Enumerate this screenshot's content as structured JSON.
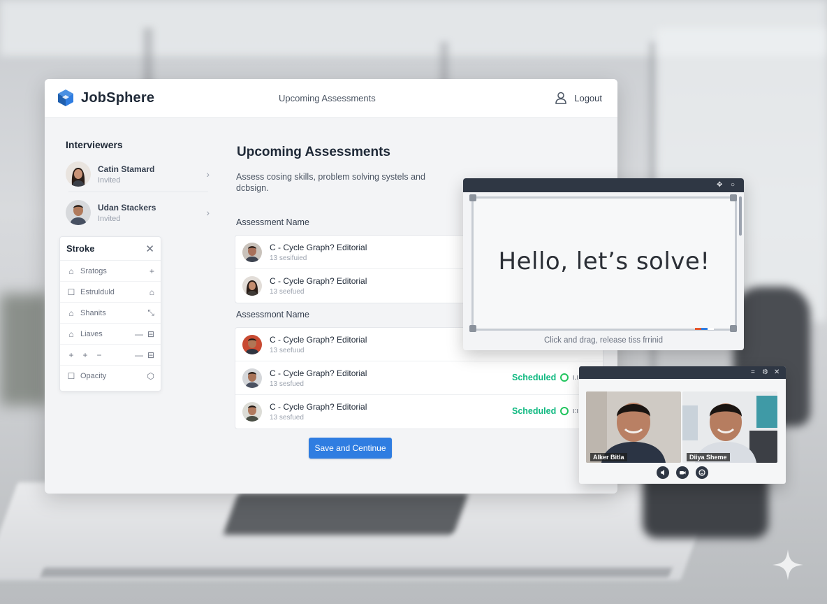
{
  "app": {
    "brand": "JobSphere",
    "nav_center": "Upcoming Assessments",
    "logout_label": "Logout"
  },
  "sidebar": {
    "title": "Interviewers",
    "interviewers": [
      {
        "name": "Catin Stamard",
        "status": "Invited"
      },
      {
        "name": "Udan Stackers",
        "status": "Invited"
      }
    ]
  },
  "stroke_panel": {
    "title": "Stroke",
    "rows": [
      {
        "label": "Sratogs"
      },
      {
        "label": "Estrulduld"
      },
      {
        "label": "Shanits"
      },
      {
        "label": "Liaves"
      },
      {
        "label": ""
      },
      {
        "label": "Opacity"
      }
    ]
  },
  "main": {
    "title": "Upcoming Assessments",
    "subtitle": "Assess cosing skills, problem solving systels and dcbsign.",
    "section1_label": "Assessment Name",
    "section2_label": "Assessmont Name",
    "group1": [
      {
        "title": "C - Cycle Graph? Editorial",
        "sub": "13 sesifuied"
      },
      {
        "title": "C - Cycle Graph? Editorial",
        "sub": "13 seefued"
      }
    ],
    "group2": [
      {
        "title": "C - Cycle Graph? Editorial",
        "sub": "13 seefuud",
        "status": ""
      },
      {
        "title": "C - Cycle Graph? Editorial",
        "sub": "13 sesfued",
        "status": "Scheduled",
        "tail": "ι.ι"
      },
      {
        "title": "C - Cycle Graph? Editorial",
        "sub": "13 sesfued",
        "status": "Scheduled",
        "tail": "ι:ι"
      }
    ],
    "save_button": "Save and Centinue"
  },
  "whiteboard": {
    "canvas_text": "Hello, let’s solve!",
    "hint": "Click and drag, release tiss frrinid"
  },
  "video_call": {
    "participants": [
      {
        "name": "Alker Bitla"
      },
      {
        "name": "Diiya Sheme"
      }
    ]
  },
  "colors": {
    "accent": "#2f7de1",
    "scheduled": "#10b981",
    "titlebar": "#2f3744"
  }
}
